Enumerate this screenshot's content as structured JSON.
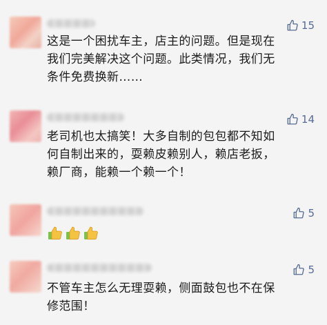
{
  "comments": [
    {
      "likes": "15",
      "text": "这是一个困扰车主，店主的问题。但是现在\n我们完美解决这个问题。此类情况，我们无\n条件免费换新……"
    },
    {
      "likes": "14",
      "text": "老司机也太搞笑！大多自制的包包都不知如\n何自制出来的，耍赖皮赖别人，赖店老扳，\n赖厂商，能赖一个赖一个！"
    },
    {
      "likes": "5",
      "emoji": [
        "thumbs-up",
        "thumbs-up",
        "thumbs-up"
      ]
    },
    {
      "likes": "5",
      "text": "不管车主怎么无理耍赖，侧面鼓包也不在保\n修范围！"
    }
  ],
  "colors": {
    "like_accent": "#576b95",
    "background": "#f4f4f4",
    "emoji_yellow": "#f6c242"
  },
  "icons": {
    "like": "thumbs-up-outline-icon",
    "emoji": "thumbs-up-emoji-icon"
  }
}
